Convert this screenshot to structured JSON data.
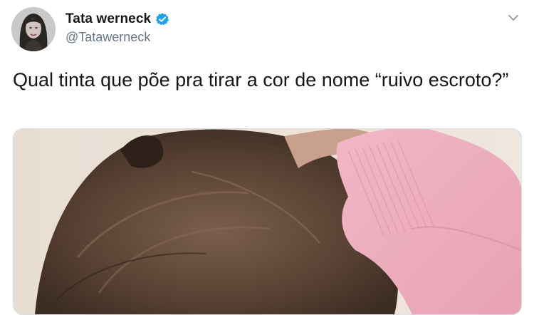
{
  "tweet": {
    "display_name": "Tata werneck",
    "handle": "@Tatawerneck",
    "text": "Qual tinta que põe pra tirar a cor de nome “ruivo escroto?”",
    "verified": true
  },
  "icons": {
    "verified": "verified-badge-icon",
    "more": "chevron-down-icon"
  },
  "colors": {
    "verified_blue": "#1da1f2",
    "name_text": "#14171a",
    "handle_text": "#657786"
  }
}
